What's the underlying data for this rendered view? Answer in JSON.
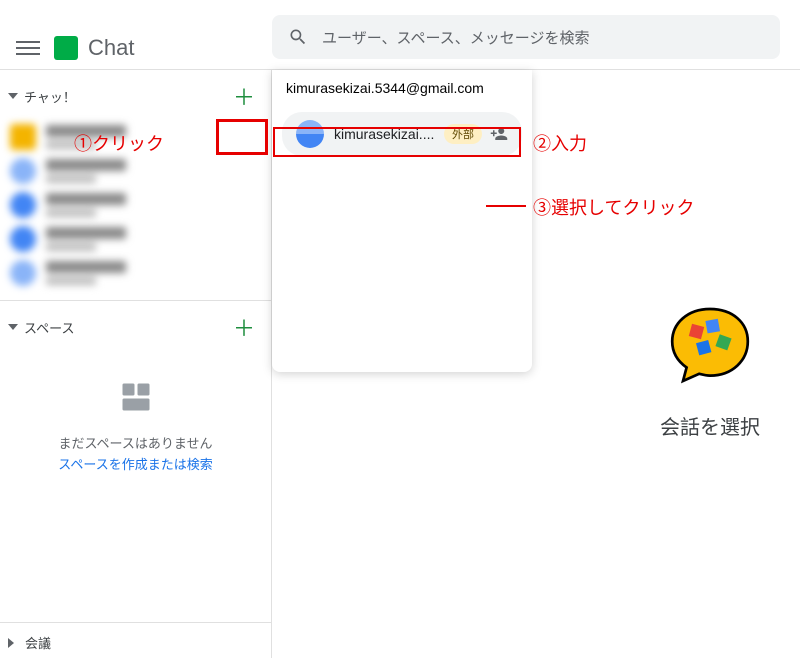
{
  "header": {
    "app_title": "Chat",
    "search_placeholder": "ユーザー、スペース、メッセージを検索"
  },
  "sidebar": {
    "chat_section": "チャッ！",
    "spaces_section": "スペース",
    "meetings_section": "会議",
    "spaces_empty_line": "まだスペースはありません",
    "spaces_empty_link": "スペースを作成または検索"
  },
  "dropdown": {
    "input_value": "kimurasekizai.5344@gmail.com",
    "result_name": "kimurasekizai....",
    "badge": "外部"
  },
  "promo": {
    "text": "会話を選択"
  },
  "annotations": {
    "a1": "①クリック",
    "a2": "②入力",
    "a3": "③選択してクリック"
  }
}
